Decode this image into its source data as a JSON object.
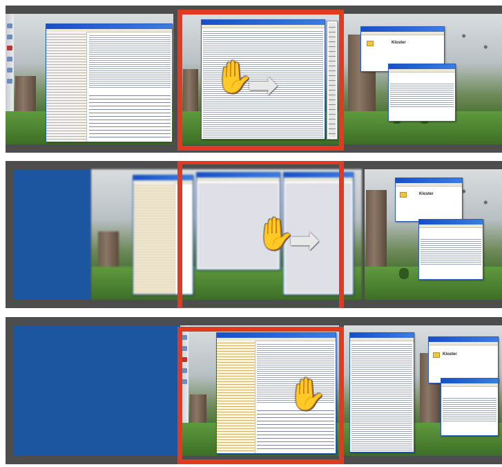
{
  "steps": [
    {
      "id": "step-1",
      "gesture": "hand-drag-right",
      "arrow": "arrow-right"
    },
    {
      "id": "step-2",
      "gesture": "hand-drag-right",
      "arrow": "arrow-right"
    },
    {
      "id": "step-3",
      "gesture": "hand-drag-right",
      "arrow": null
    }
  ],
  "glyphs": {
    "hand": "✋",
    "arrow": "➡"
  },
  "window_title_label": "Kloster",
  "colors": {
    "frame": "#e13a22",
    "background": "#4d4d4d",
    "desktop_blue": "#1c55a0",
    "window_titlebar": "#1650c8"
  }
}
